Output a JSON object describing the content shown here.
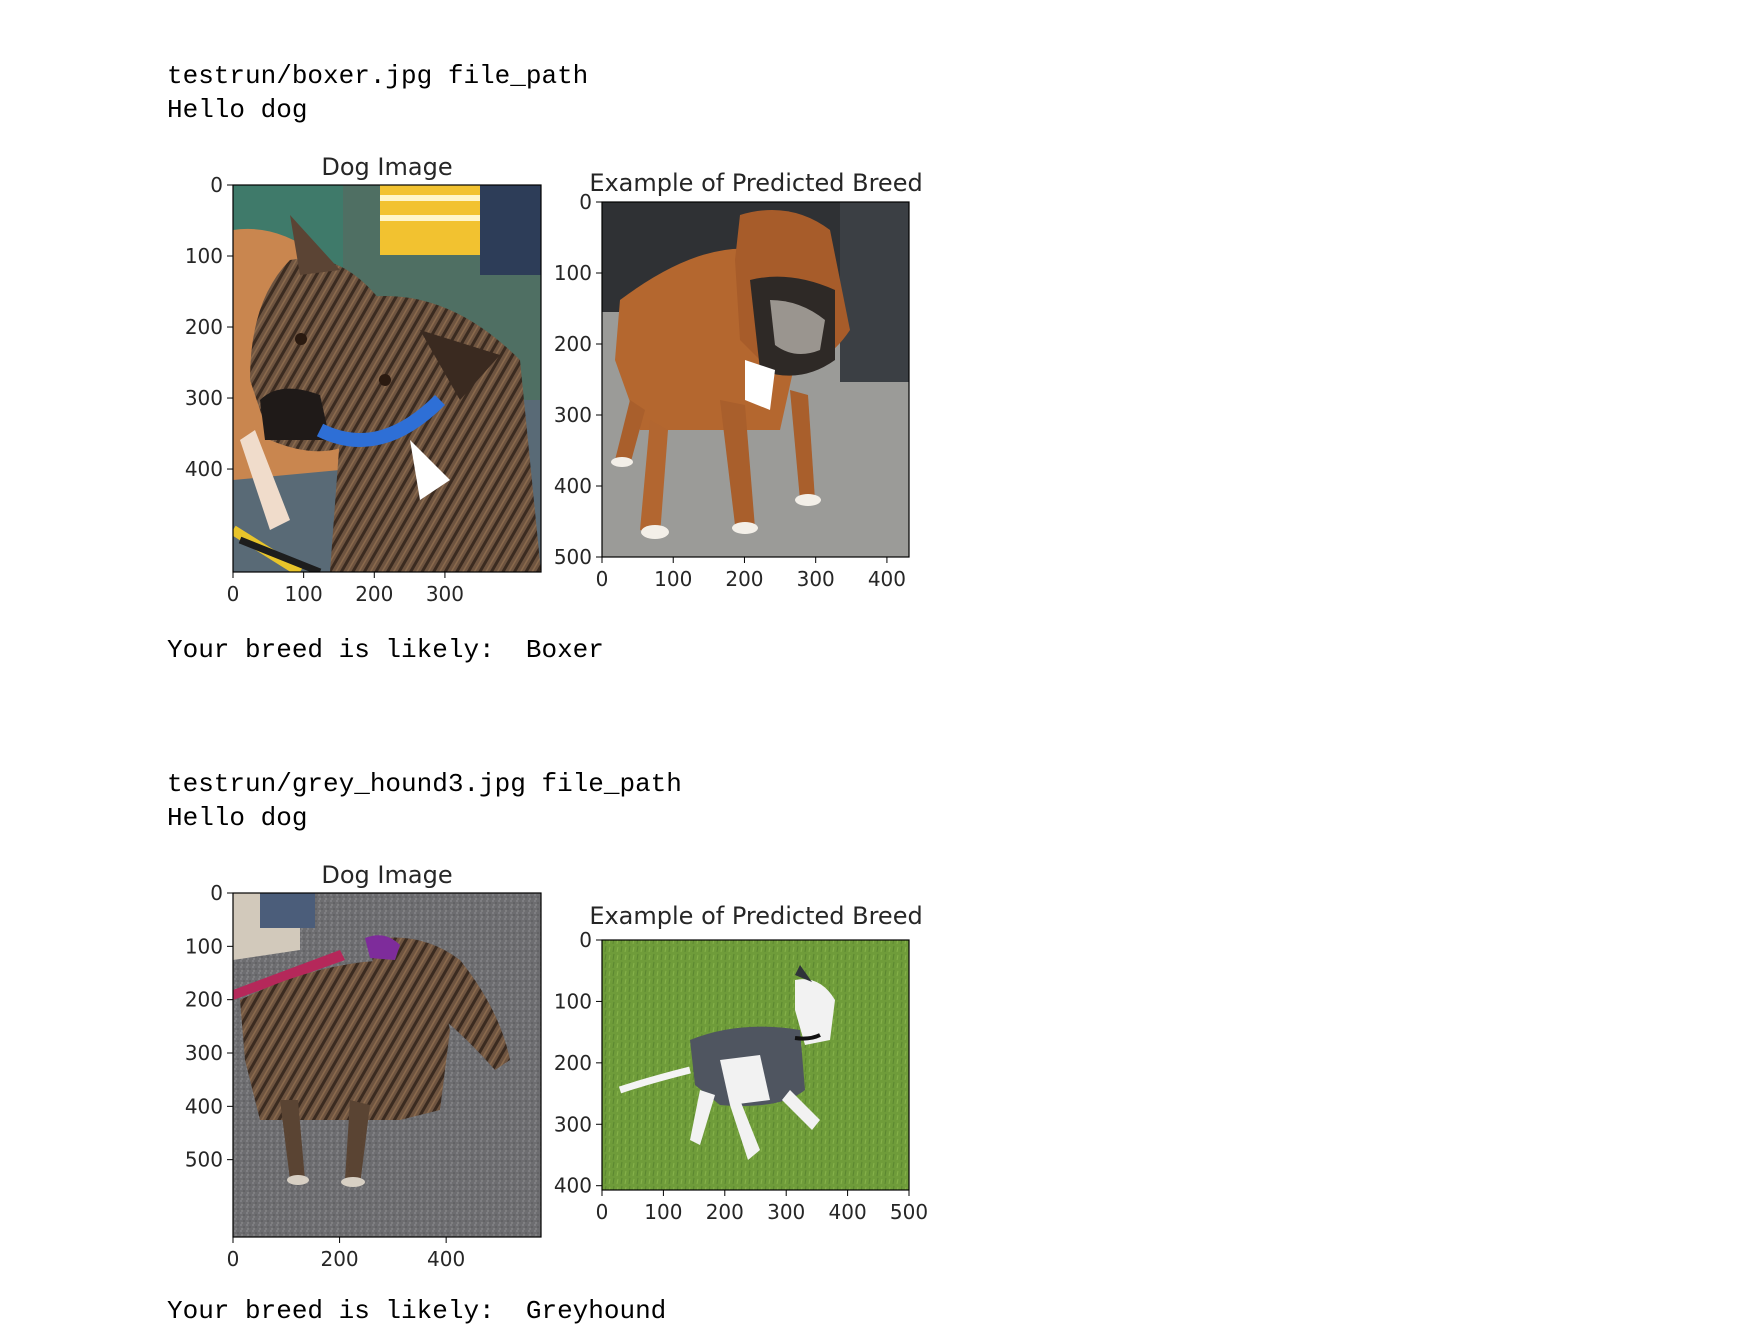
{
  "outputs": [
    {
      "file_line": "testrun/boxer.jpg file_path",
      "greeting": "Hello dog",
      "result_line": "Your breed is likely:  Boxer",
      "figures": [
        {
          "title": "Dog Image",
          "xticks": [
            "0",
            "100",
            "200",
            "300"
          ],
          "yticks": [
            "0",
            "100",
            "200",
            "300",
            "400"
          ],
          "image": "brindle-boxer-mix-photo"
        },
        {
          "title": "Example of Predicted Breed",
          "xticks": [
            "0",
            "100",
            "200",
            "300",
            "400"
          ],
          "yticks": [
            "0",
            "100",
            "200",
            "300",
            "400",
            "500"
          ],
          "image": "fawn-boxer-photo"
        }
      ]
    },
    {
      "file_line": "testrun/grey_hound3.jpg file_path",
      "greeting": "Hello dog",
      "result_line": "Your breed is likely:  Greyhound",
      "figures": [
        {
          "title": "Dog Image",
          "xticks": [
            "0",
            "200",
            "400"
          ],
          "yticks": [
            "0",
            "100",
            "200",
            "300",
            "400",
            "500"
          ],
          "image": "brindle-greyhound-on-asphalt-photo"
        },
        {
          "title": "Example of Predicted Breed",
          "xticks": [
            "0",
            "100",
            "200",
            "300",
            "400",
            "500"
          ],
          "yticks": [
            "0",
            "100",
            "200",
            "300",
            "400"
          ],
          "image": "white-grey-greyhound-running-on-grass-photo"
        }
      ]
    }
  ]
}
